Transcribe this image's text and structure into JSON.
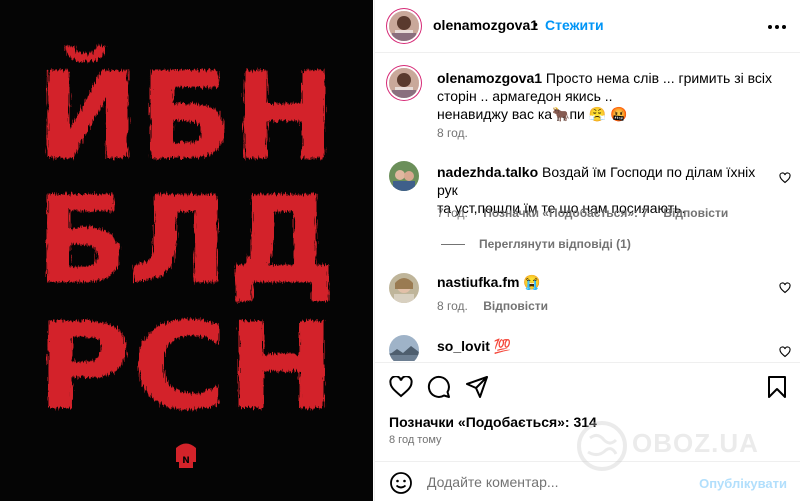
{
  "post": {
    "image_text_lines": [
      "ЙБН",
      "БЛД",
      "РСН"
    ],
    "image_text_color": "#d3232a",
    "image_bg_color": "#050505"
  },
  "header": {
    "username": "olenamozgova1",
    "separator": "•",
    "follow_label": "Стежити",
    "more_icon": "more-horizontal-icon"
  },
  "caption": {
    "username": "olenamozgova1",
    "text_line1": "Просто нема слів ... гримить зі всіх",
    "text_line2": "сторін .. армагедон якись ..",
    "text_line3": "ненавиджу вас ка🐂пи 😤 🤬",
    "time": "8 год."
  },
  "comments": [
    {
      "username": "nadezhda.talko",
      "text_line1": "Воздай їм Господи по ділам їхніх рук",
      "text_line2": "та уст,пошли їм те що нам посилають.",
      "time": "7 год.",
      "likes": "Позначки «Подобається»: 7",
      "reply": "Відповісти",
      "view_replies": "Переглянути відповіді (1)"
    },
    {
      "username": "nastiufka.fm",
      "text": "😭",
      "time": "8 год.",
      "reply": "Відповісти"
    },
    {
      "username": "so_lovit",
      "text": "💯"
    }
  ],
  "footer": {
    "likes": "Позначки «Подобається»: 314",
    "ago": "8 год тому",
    "add_comment_placeholder": "Додайте коментар...",
    "publish_label": "Опублікувати"
  },
  "watermark": {
    "text": "OBOZ.UA"
  }
}
